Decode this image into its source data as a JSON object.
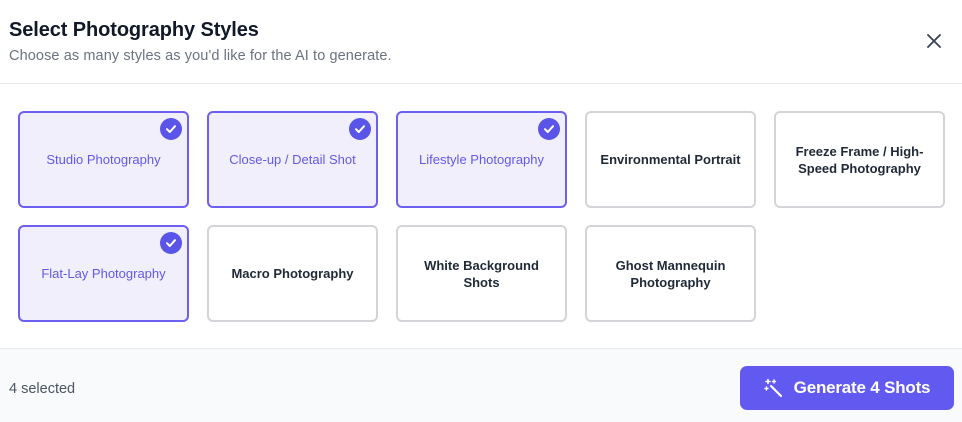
{
  "header": {
    "title": "Select Photography Styles",
    "subtitle": "Choose as many styles as you'd like for the AI to generate.",
    "close_icon": "close-icon"
  },
  "styles": [
    {
      "label": "Studio Photography",
      "selected": true
    },
    {
      "label": "Close-up / Detail Shot",
      "selected": true
    },
    {
      "label": "Lifestyle Photography",
      "selected": true
    },
    {
      "label": "Environmental Portrait",
      "selected": false
    },
    {
      "label": "Freeze Frame / High-Speed Photography",
      "selected": false
    },
    {
      "label": "Flat-Lay Photography",
      "selected": true
    },
    {
      "label": "Macro Photography",
      "selected": false
    },
    {
      "label": "White Background Shots",
      "selected": false
    },
    {
      "label": "Ghost Mannequin Photography",
      "selected": false
    }
  ],
  "footer": {
    "selected_count": "4 selected",
    "generate_label": "Generate 4 Shots",
    "generate_icon": "magic-wand-icon"
  },
  "colors": {
    "accent": "#6259f0",
    "selected_bg": "#f1effc",
    "selected_border": "#6d5ff0"
  }
}
